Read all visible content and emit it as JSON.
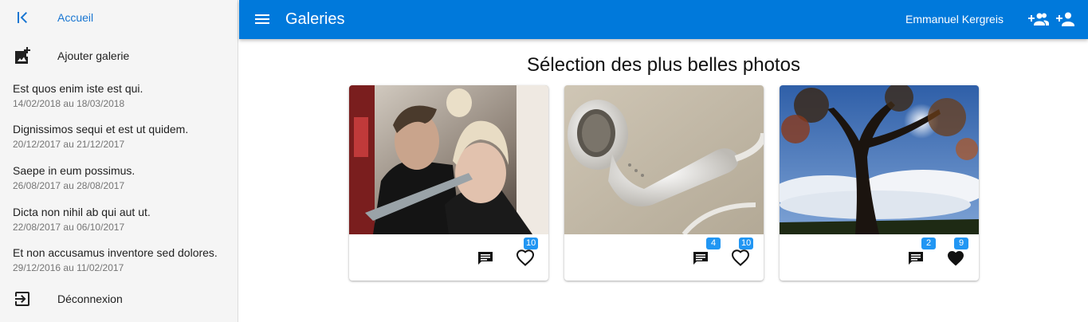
{
  "sidebar": {
    "home_label": "Accueil",
    "add_gallery_label": "Ajouter galerie",
    "logout_label": "Déconnexion",
    "galleries": [
      {
        "title": "Est quos enim iste est qui.",
        "dates": "14/02/2018 au 18/03/2018"
      },
      {
        "title": "Dignissimos sequi et est ut quidem.",
        "dates": "20/12/2017 au 21/12/2017"
      },
      {
        "title": "Saepe in eum possimus.",
        "dates": "26/08/2017 au 28/08/2017"
      },
      {
        "title": "Dicta non nihil ab qui aut ut.",
        "dates": "22/08/2017 au 06/10/2017"
      },
      {
        "title": "Et non accusamus inventore sed dolores.",
        "dates": "29/12/2016 au 11/02/2017"
      }
    ]
  },
  "topbar": {
    "title": "Galeries",
    "user_name": "Emmanuel Kergreis",
    "icons": [
      "menu-icon",
      "group-add-icon",
      "person-add-icon"
    ]
  },
  "main": {
    "heading": "Sélection des plus belles photos",
    "cards": [
      {
        "photo": "couple-knife-photo",
        "comments": "",
        "likes": "10",
        "liked": false
      },
      {
        "photo": "earphones-photo",
        "comments": "4",
        "likes": "10",
        "liked": false
      },
      {
        "photo": "tree-sky-photo",
        "comments": "2",
        "likes": "9",
        "liked": true
      }
    ]
  },
  "colors": {
    "primary": "#0079db",
    "badge": "#2196f3",
    "sidebar_bg": "#f5f5f5",
    "link": "#1976d2"
  }
}
